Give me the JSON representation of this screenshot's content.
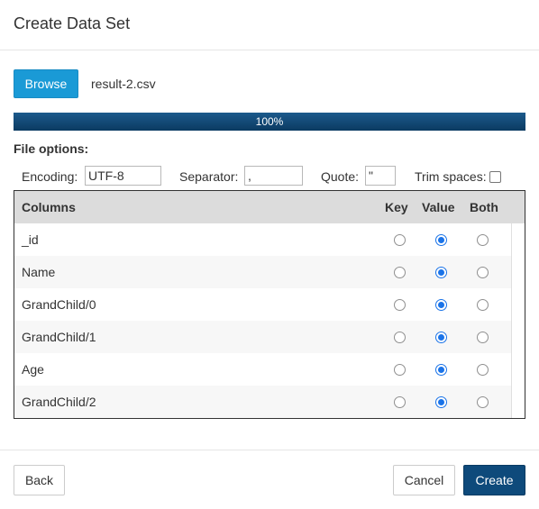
{
  "dialog": {
    "title": "Create Data Set"
  },
  "file": {
    "browse_label": "Browse",
    "name": "result-2.csv"
  },
  "progress": {
    "percent": 100,
    "label": "100%"
  },
  "options": {
    "title": "File options:",
    "encoding_label": "Encoding:",
    "encoding_value": "UTF-8",
    "separator_label": "Separator:",
    "separator_value": ",",
    "quote_label": "Quote:",
    "quote_value": "\"",
    "trim_label": "Trim spaces:",
    "trim_checked": false
  },
  "grid": {
    "headers": {
      "columns": "Columns",
      "key": "Key",
      "value": "Value",
      "both": "Both"
    },
    "rows": [
      {
        "name": "_id",
        "selected": "value"
      },
      {
        "name": "Name",
        "selected": "value"
      },
      {
        "name": "GrandChild/0",
        "selected": "value"
      },
      {
        "name": "GrandChild/1",
        "selected": "value"
      },
      {
        "name": "Age",
        "selected": "value"
      },
      {
        "name": "GrandChild/2",
        "selected": "value"
      }
    ]
  },
  "footer": {
    "back_label": "Back",
    "cancel_label": "Cancel",
    "create_label": "Create"
  },
  "colors": {
    "accent": "#1a9ad6",
    "primary": "#0e4a7b",
    "progress": "#0f4470",
    "radio_checked": "#1a73e8"
  }
}
